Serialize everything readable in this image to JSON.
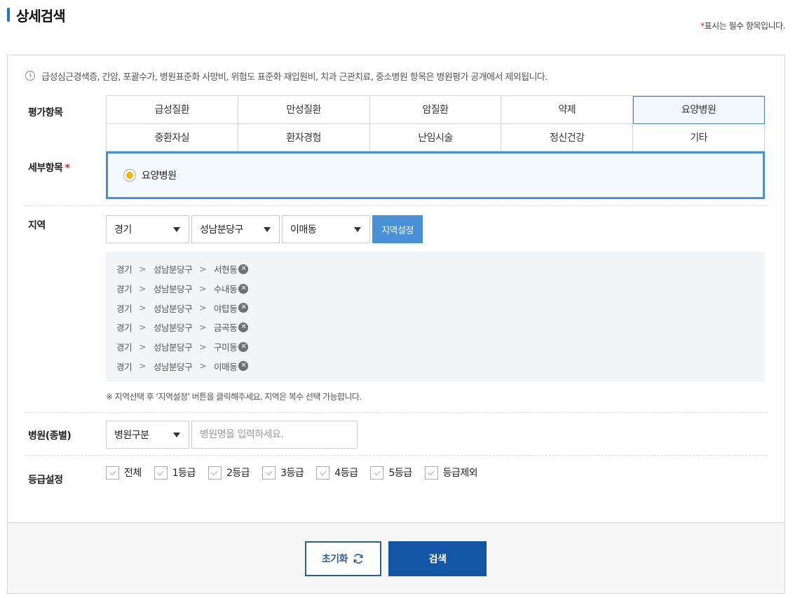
{
  "header": {
    "title": "상세검색",
    "required_note_star": "*",
    "required_note_text": "표시는 필수 항목입니다."
  },
  "notice": {
    "icon": "info-icon",
    "text": "급성심근경색증, 간암, 포괄수가, 병원표준화 사망비, 위험도 표준화 재입원비, 치과 근관치료, 중소병원 항목은 병원평가 공개에서 제외됩니다."
  },
  "evaluation": {
    "label": "평가항목",
    "items": [
      "급성질환",
      "만성질환",
      "암질환",
      "약제",
      "요양병원",
      "중환자실",
      "환자경험",
      "난임시술",
      "정신건강",
      "기타"
    ],
    "selected": "요양병원"
  },
  "detail": {
    "label": "세부항목",
    "required_star": "*",
    "option": "요양병원"
  },
  "region": {
    "label": "지역",
    "province": "경기",
    "city": "성남분당구",
    "dong": "이매동",
    "set_button": "지역설정",
    "separator": ">",
    "selected": [
      {
        "province": "경기",
        "city": "성남분당구",
        "dong": "서현동"
      },
      {
        "province": "경기",
        "city": "성남분당구",
        "dong": "수내동"
      },
      {
        "province": "경기",
        "city": "성남분당구",
        "dong": "야탑동"
      },
      {
        "province": "경기",
        "city": "성남분당구",
        "dong": "금곡동"
      },
      {
        "province": "경기",
        "city": "성남분당구",
        "dong": "구미동"
      },
      {
        "province": "경기",
        "city": "성남분당구",
        "dong": "이매동"
      }
    ],
    "hint": "※ 지역선택 후 ‘지역설정’ 버튼을 클릭해주세요. 지역은 복수 선택 가능합니다."
  },
  "hospital": {
    "label": "병원(종별)",
    "type_select": "병원구분",
    "name_placeholder": "병원명을 입력하세요."
  },
  "grade": {
    "label": "등급설정",
    "options": [
      "전체",
      "1등급",
      "2등급",
      "3등급",
      "4등급",
      "5등급",
      "등급제외"
    ]
  },
  "actions": {
    "reset": "초기화",
    "search": "검색"
  },
  "colors": {
    "accent": "#4a90d9",
    "primary_button": "#1356a5",
    "radio_selected": "#f5b400",
    "required": "#d6262a"
  }
}
